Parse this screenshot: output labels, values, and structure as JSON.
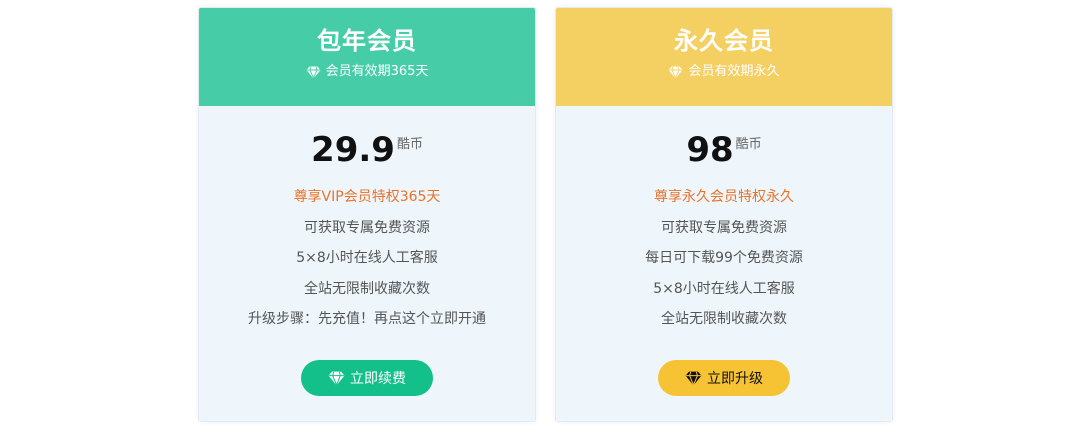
{
  "colors": {
    "annual_header": "#46cda8",
    "lifetime_header": "#f4cf62",
    "card_body": "#eef6fc",
    "annual_button": "#14c08a",
    "lifetime_button": "#f6c334",
    "highlight_text": "#e8742a"
  },
  "plans": [
    {
      "title": "包年会员",
      "validity_icon": "diamond-icon",
      "validity": "会员有效期365天",
      "price": "29.9",
      "currency": "酷币",
      "features": [
        "尊享VIP会员特权365天",
        "可获取专属免费资源",
        "5×8小时在线人工客服",
        "全站无限制收藏次数",
        "升级步骤：先充值！再点这个立即开通"
      ],
      "button_icon": "diamond-icon",
      "button_label": "立即续费"
    },
    {
      "title": "永久会员",
      "validity_icon": "diamond-icon",
      "validity": "会员有效期永久",
      "price": "98",
      "currency": "酷币",
      "features": [
        "尊享永久会员特权永久",
        "可获取专属免费资源",
        "每日可下载99个免费资源",
        "5×8小时在线人工客服",
        "全站无限制收藏次数"
      ],
      "button_icon": "diamond-icon",
      "button_label": "立即升级"
    }
  ]
}
